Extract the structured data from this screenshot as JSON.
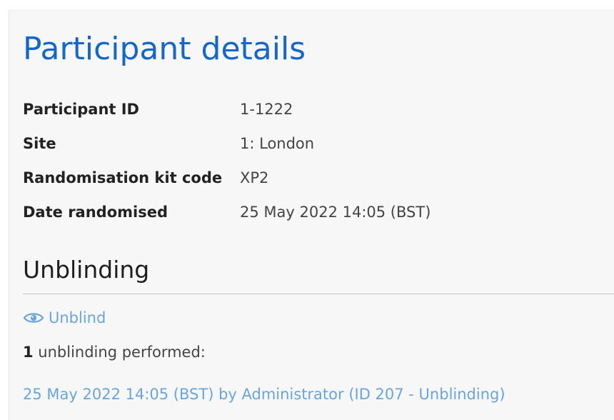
{
  "page": {
    "title": "Participant details"
  },
  "details": [
    {
      "label": "Participant ID",
      "value": "1-1222"
    },
    {
      "label": "Site",
      "value": "1: London"
    },
    {
      "label": "Randomisation kit code",
      "value": "XP2"
    },
    {
      "label": "Date randomised",
      "value": "25 May 2022 14:05 (BST)"
    }
  ],
  "unblinding": {
    "heading": "Unblinding",
    "action_label": "Unblind",
    "action_icon": "eye-icon",
    "count": "1",
    "count_suffix": " unblinding performed:",
    "entries": [
      {
        "text": "25 May 2022 14:05 (BST) by Administrator (ID 207 - Unblinding)"
      }
    ]
  },
  "colors": {
    "title": "#1467c9",
    "link": "#6aa5dc",
    "panel_bg": "#f7f7f7",
    "divider": "#c6c6c6"
  }
}
